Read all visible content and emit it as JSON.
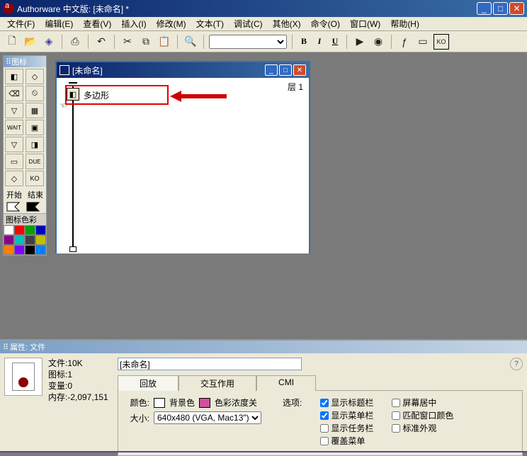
{
  "title": "Authorware 中文版: [未命名] *",
  "menus": [
    "文件(F)",
    "编辑(E)",
    "查看(V)",
    "插入(I)",
    "修改(M)",
    "文本(T)",
    "调试(C)",
    "其他(X)",
    "命令(O)",
    "窗口(W)",
    "帮助(H)"
  ],
  "toolbar": {
    "font_select": "",
    "bold": "B",
    "italic": "I",
    "underline": "U"
  },
  "palette": {
    "title": "图标",
    "start": "开始",
    "end": "结束",
    "colors_title": "图标色彩",
    "colors": [
      "#ffffff",
      "#ff0000",
      "#00a000",
      "#0000c0",
      "#8b008b",
      "#00c0c0",
      "#404040",
      "#c0c000",
      "#ff8000",
      "#8000ff",
      "#000000",
      "#0080ff"
    ]
  },
  "design": {
    "title": "[未命名]",
    "layer_label": "层 1",
    "icon_label": "多边形"
  },
  "props": {
    "title": "属性: 文件",
    "filename": "[未命名]",
    "info_lines": {
      "l1": "文件:10K",
      "l2": "图标:1",
      "l3": "变量:0",
      "l4": "内存:-2,097,151"
    },
    "tabs": {
      "t1": "回放",
      "t2": "交互作用",
      "t3": "CMI"
    },
    "color_label": "颜色:",
    "bg_label": "背景色",
    "chroma_label": "色彩浓度关",
    "size_label": "大小:",
    "size_value": "640x480 (VGA, Mac13\")",
    "options_label": "选项:",
    "opt1": "显示标题栏",
    "opt2": "显示菜单栏",
    "opt3": "显示任务栏",
    "opt4": "覆盖菜单",
    "opt5": "屏幕居中",
    "opt6": "匹配窗口颜色",
    "opt7": "标准外观"
  }
}
